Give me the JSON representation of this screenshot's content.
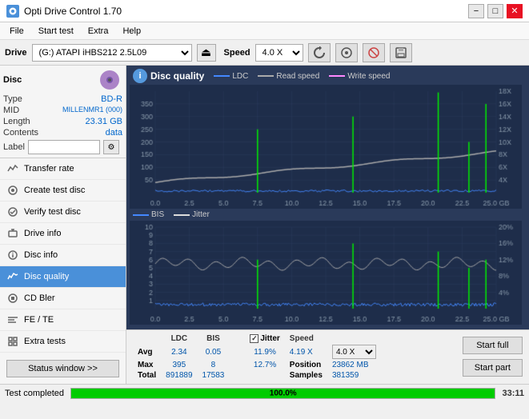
{
  "titlebar": {
    "title": "Opti Drive Control 1.70",
    "icon": "★",
    "minimize": "−",
    "maximize": "□",
    "close": "✕"
  },
  "menubar": {
    "items": [
      "File",
      "Start test",
      "Extra",
      "Help"
    ]
  },
  "toolbar": {
    "drive_label": "Drive",
    "drive_value": "(G:) ATAPI iHBS212 2.5L09",
    "speed_label": "Speed",
    "speed_value": "4.0 X"
  },
  "disc": {
    "title": "Disc",
    "type_label": "Type",
    "type_value": "BD-R",
    "mid_label": "MID",
    "mid_value": "MILLENMR1 (000)",
    "length_label": "Length",
    "length_value": "23.31 GB",
    "contents_label": "Contents",
    "contents_value": "data",
    "label_label": "Label"
  },
  "nav": {
    "items": [
      {
        "id": "transfer-rate",
        "label": "Transfer rate",
        "active": false
      },
      {
        "id": "create-test",
        "label": "Create test disc",
        "active": false
      },
      {
        "id": "verify-test",
        "label": "Verify test disc",
        "active": false
      },
      {
        "id": "drive-info",
        "label": "Drive info",
        "active": false
      },
      {
        "id": "disc-info",
        "label": "Disc info",
        "active": false
      },
      {
        "id": "disc-quality",
        "label": "Disc quality",
        "active": true
      },
      {
        "id": "cd-bler",
        "label": "CD Bler",
        "active": false
      },
      {
        "id": "fe-te",
        "label": "FE / TE",
        "active": false
      },
      {
        "id": "extra-tests",
        "label": "Extra tests",
        "active": false
      }
    ],
    "status_btn": "Status window >>"
  },
  "disc_quality": {
    "title": "Disc quality",
    "legend": [
      {
        "label": "LDC",
        "color": "#5599ff"
      },
      {
        "label": "Read speed",
        "color": "#aaaaaa"
      },
      {
        "label": "Write speed",
        "color": "#ff88ff"
      }
    ],
    "legend2": [
      {
        "label": "BIS",
        "color": "#5599ff"
      },
      {
        "label": "Jitter",
        "color": "#aaaaaa"
      }
    ]
  },
  "stats": {
    "headers": [
      "LDC",
      "BIS",
      "",
      "Jitter",
      "Speed",
      ""
    ],
    "avg_label": "Avg",
    "avg_ldc": "2.34",
    "avg_bis": "0.05",
    "avg_jitter": "11.9%",
    "avg_speed": "4.19 X",
    "max_label": "Max",
    "max_ldc": "395",
    "max_bis": "8",
    "max_jitter": "12.7%",
    "max_position": "23862 MB",
    "total_label": "Total",
    "total_ldc": "891889",
    "total_bis": "17583",
    "total_samples": "381359",
    "position_label": "Position",
    "samples_label": "Samples",
    "jitter_check": "✓",
    "speed_dropdown": "4.0 X",
    "btn_full": "Start full",
    "btn_part": "Start part"
  },
  "bottombar": {
    "status": "Test completed",
    "progress": "100.0%",
    "progress_value": 100,
    "time": "33:11"
  },
  "colors": {
    "ldc_line": "#4488ff",
    "bis_line": "#4488ff",
    "jitter_line": "#bbbbbb",
    "read_speed_line": "#cccccc",
    "spike_color": "#00ff00",
    "chart_bg": "#1e2d4a",
    "chart_grid": "#2a3d5a",
    "sidebar_active": "#4a90d9",
    "accent": "#0066cc"
  }
}
